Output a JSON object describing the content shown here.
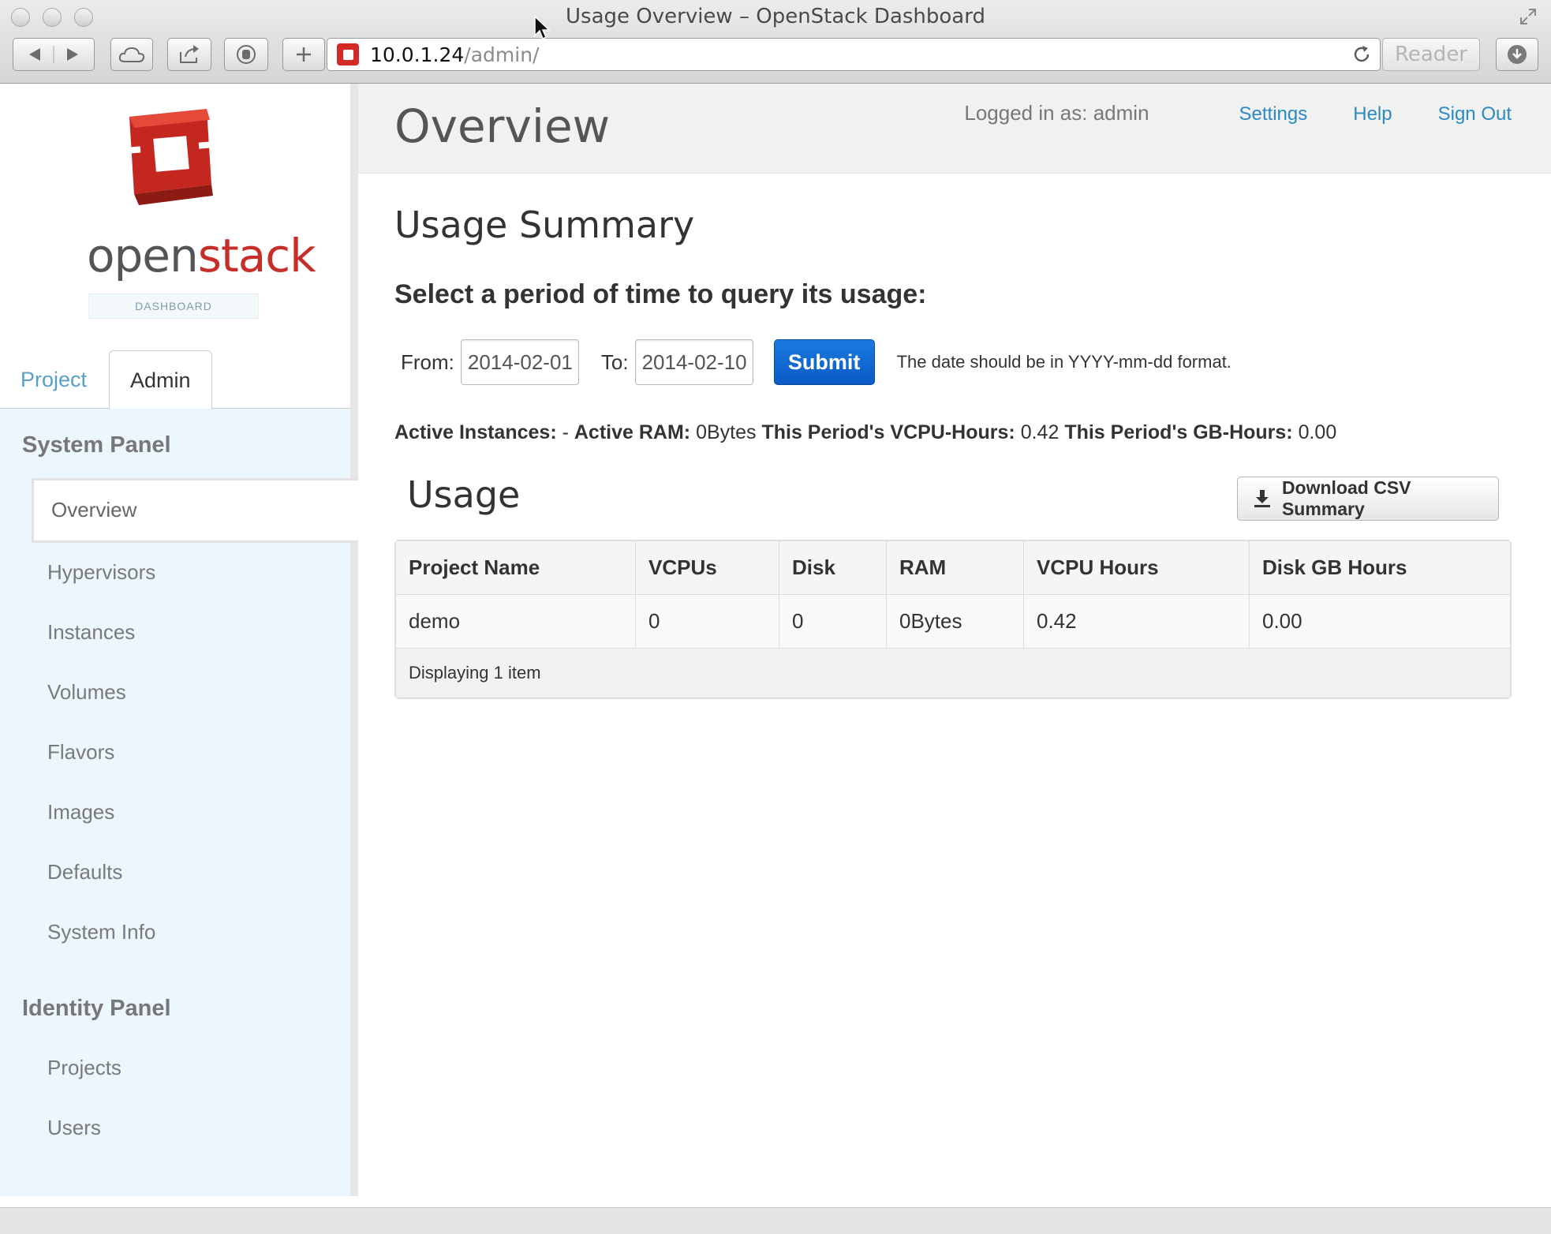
{
  "window": {
    "title": "Usage Overview – OpenStack Dashboard"
  },
  "browser": {
    "url_host": "10.0.1.24",
    "url_path": "/admin/",
    "reader_label": "Reader"
  },
  "logo": {
    "word_open": "open",
    "word_stack": "stack",
    "subtitle": "DASHBOARD"
  },
  "sidebar": {
    "tabs": [
      {
        "label": "Project"
      },
      {
        "label": "Admin"
      }
    ],
    "system_panel": {
      "heading": "System Panel",
      "items": [
        {
          "label": "Overview"
        },
        {
          "label": "Hypervisors"
        },
        {
          "label": "Instances"
        },
        {
          "label": "Volumes"
        },
        {
          "label": "Flavors"
        },
        {
          "label": "Images"
        },
        {
          "label": "Defaults"
        },
        {
          "label": "System Info"
        }
      ]
    },
    "identity_panel": {
      "heading": "Identity Panel",
      "items": [
        {
          "label": "Projects"
        },
        {
          "label": "Users"
        }
      ]
    }
  },
  "header": {
    "title": "Overview",
    "logged_in": "Logged in as: admin",
    "links": [
      {
        "label": "Settings"
      },
      {
        "label": "Help"
      },
      {
        "label": "Sign Out"
      }
    ]
  },
  "main": {
    "summary_title": "Usage Summary",
    "query_title": "Select a period of time to query its usage:",
    "form": {
      "from_label": "From:",
      "from_value": "2014-02-01",
      "to_label": "To:",
      "to_value": "2014-02-10",
      "submit_label": "Submit",
      "hint": "The date should be in YYYY-mm-dd format."
    },
    "stats": {
      "active_instances_label": "Active Instances:",
      "active_instances_value": "-",
      "active_ram_label": "Active RAM:",
      "active_ram_value": "0Bytes",
      "vcpu_hours_label": "This Period's VCPU-Hours:",
      "vcpu_hours_value": "0.42",
      "gb_hours_label": "This Period's GB-Hours:",
      "gb_hours_value": "0.00"
    },
    "usage_title": "Usage",
    "csv_label": "Download CSV Summary",
    "table": {
      "columns": [
        "Project Name",
        "VCPUs",
        "Disk",
        "RAM",
        "VCPU Hours",
        "Disk GB Hours"
      ],
      "rows": [
        [
          "demo",
          "0",
          "0",
          "0Bytes",
          "0.42",
          "0.00"
        ]
      ],
      "footer": "Displaying 1 item"
    }
  }
}
